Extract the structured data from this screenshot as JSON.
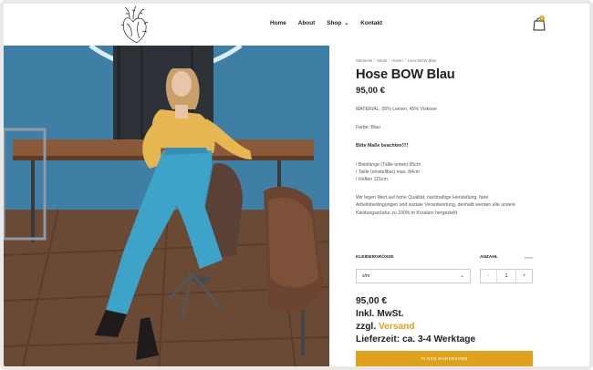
{
  "nav": {
    "items": [
      "Home",
      "About",
      "Shop",
      "Kontakt"
    ],
    "shop_chevron": "⌄"
  },
  "cart": {
    "count": "0",
    "icon": "shopping-bag-icon"
  },
  "breadcrumb": [
    "Startseite",
    "Mode",
    "Hosen",
    "Hose BOW Blau"
  ],
  "product": {
    "title": "Hose BOW Blau",
    "price": "95,00 €",
    "material": "MATERIAL: 55% Leinen, 45% Viskose",
    "color": "Farbe: Blau",
    "notice": "Bitte Maße beachten!!!!",
    "measures": [
      "/ Beinlänge (Taille unten) 95cm",
      "/ Taille (einstellbar) max. 84cm",
      "/ Hüften 115cm"
    ],
    "statement": "Wir legen Wert auf hohe Qualität, nachhaltige Herstellung, faire Arbeitsbedingungen und soziale Verantwortung, deshalb werden alle unsere Kleidungsstücke zu 100% in Kroatien hergestellt."
  },
  "options": {
    "size_label": "KLEIDERGRÖSSE",
    "size_value": "s/m",
    "qty_label": "ANZAHL",
    "reset_label": "reset",
    "qty_value": "1",
    "minus": "-",
    "plus": "+"
  },
  "summary": {
    "price": "95,00 €",
    "tax": "Inkl. MwSt.",
    "shipping_prefix": "zzgl.",
    "shipping_link": "Versand",
    "delivery": "Lieferzeit: ca. 3-4 Werktage"
  },
  "cta": {
    "label": "IN DEN WARENKORB"
  },
  "colors": {
    "accent": "#e0a21c",
    "wall": "#3f7fa6",
    "floor": "#6b4a35"
  }
}
